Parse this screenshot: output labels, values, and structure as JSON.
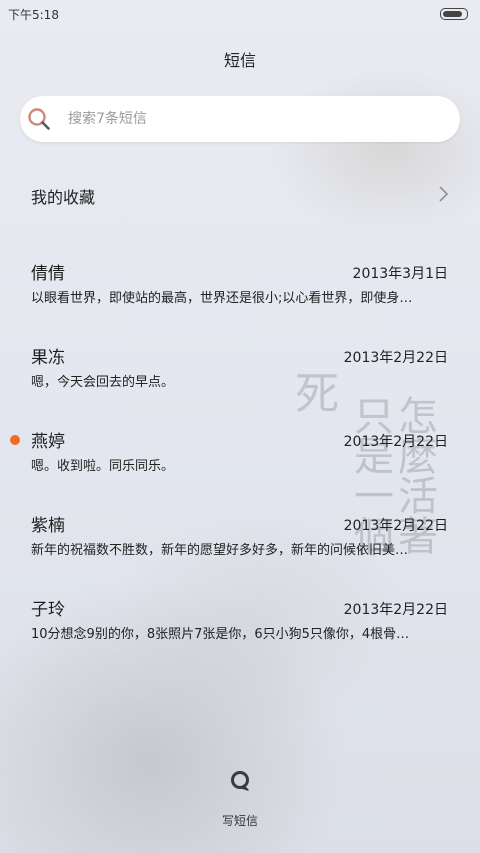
{
  "status_bar": {
    "time": "下午5:18",
    "battery_level": 0.85
  },
  "header": {
    "title": "短信"
  },
  "search": {
    "placeholder": "搜索7条短信",
    "icon": "search-icon"
  },
  "favorites": {
    "label": "我的收藏",
    "icon": "chevron-right-icon"
  },
  "wallpaper_text": {
    "a": "死",
    "b": "只是一個",
    "c": "怎麼活著"
  },
  "messages": [
    {
      "name": "倩倩",
      "date": "2013年3月1日",
      "preview": "以眼看世界，即使站的最高，世界还是很小;以心看世界，即使身…",
      "unread": false
    },
    {
      "name": "果冻",
      "date": "2013年2月22日",
      "preview": "嗯，今天会回去的早点。",
      "unread": false
    },
    {
      "name": "燕婷",
      "date": "2013年2月22日",
      "preview": "嗯。收到啦。同乐同乐。",
      "unread": true
    },
    {
      "name": "紫楠",
      "date": "2013年2月22日",
      "preview": "新年的祝福数不胜数，新年的愿望好多好多，新年的问候依旧美…",
      "unread": false
    },
    {
      "name": "子玲",
      "date": "2013年2月22日",
      "preview": "10分想念9别的你，8张照片7张是你，6只小狗5只像你，4根骨…",
      "unread": false
    }
  ],
  "compose": {
    "label": "写短信",
    "icon": "compose-message-icon"
  },
  "colors": {
    "unread": "#f36a22",
    "background": "#e6e9f0",
    "search_bg": "#ffffff"
  }
}
